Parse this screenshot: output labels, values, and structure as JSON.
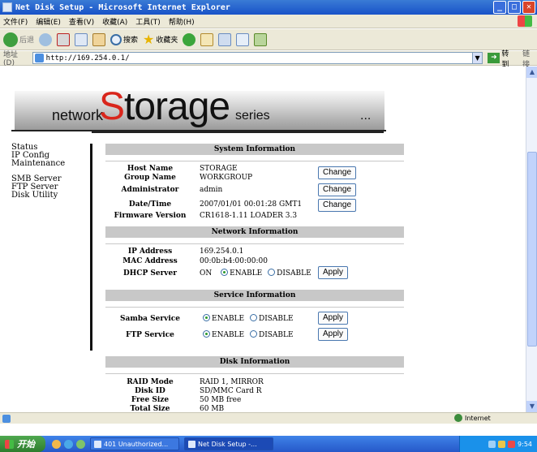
{
  "window": {
    "title": "Net Disk Setup - Microsoft Internet Explorer",
    "controls": [
      "_",
      "□",
      "✕"
    ]
  },
  "menu": [
    "文件(F)",
    "编辑(E)",
    "查看(V)",
    "收藏(A)",
    "工具(T)",
    "帮助(H)"
  ],
  "toolbar": {
    "back_label": "后退",
    "search_label": "搜索",
    "favorites_label": "收藏夹"
  },
  "address": {
    "label": "地址(D)",
    "url": "http://169.254.0.1/",
    "go_label": "转到",
    "links_label": "链接"
  },
  "banner": {
    "network": "network",
    "storage_first": "S",
    "storage_rest": "torage",
    "series": "series",
    "dots": "..."
  },
  "nav": {
    "items": [
      "Status",
      "IP Config",
      "Maintenance",
      "SMB Server",
      "FTP Server",
      "Disk Utility"
    ]
  },
  "system": {
    "header": "System Information",
    "rows": [
      {
        "label": "Host Name",
        "value": "STORAGE"
      },
      {
        "label": "Group Name",
        "value": "WORKGROUP"
      },
      {
        "label": "Administrator",
        "value": "admin"
      },
      {
        "label": "Date/Time",
        "value": "2007/01/01 00:01:28 GMT1"
      },
      {
        "label": "Firmware Version",
        "value": "CR1618-1.11 LOADER 3.3"
      }
    ],
    "change_label": "Change"
  },
  "network": {
    "header": "Network Information",
    "rows": [
      {
        "label": "IP Address",
        "value": "169.254.0.1"
      },
      {
        "label": "MAC Address",
        "value": "00:0b:b4:00:00:00"
      },
      {
        "label": "DHCP Server",
        "value": "ON"
      }
    ],
    "enable_label": "ENABLE",
    "disable_label": "DISABLE",
    "apply_label": "Apply"
  },
  "service": {
    "header": "Service Information",
    "rows": [
      {
        "label": "Samba Service"
      },
      {
        "label": "FTP Service"
      }
    ],
    "enable_label": "ENABLE",
    "disable_label": "DISABLE",
    "apply_label": "Apply"
  },
  "disk": {
    "header": "Disk Information",
    "rows": [
      {
        "label": "RAID Mode",
        "value": "RAID 1, MIRROR"
      },
      {
        "label": "Disk ID",
        "value": "SD/MMC Card R"
      },
      {
        "label": "Free Size",
        "value": "50 MB free"
      },
      {
        "label": "Total Size",
        "value": "60 MB"
      }
    ]
  },
  "statusbar": {
    "zone": "Internet"
  },
  "taskbar": {
    "start": "开始",
    "tasks": [
      "401 Unauthorized...",
      "Net Disk Setup -..."
    ],
    "clock": "9:54"
  }
}
